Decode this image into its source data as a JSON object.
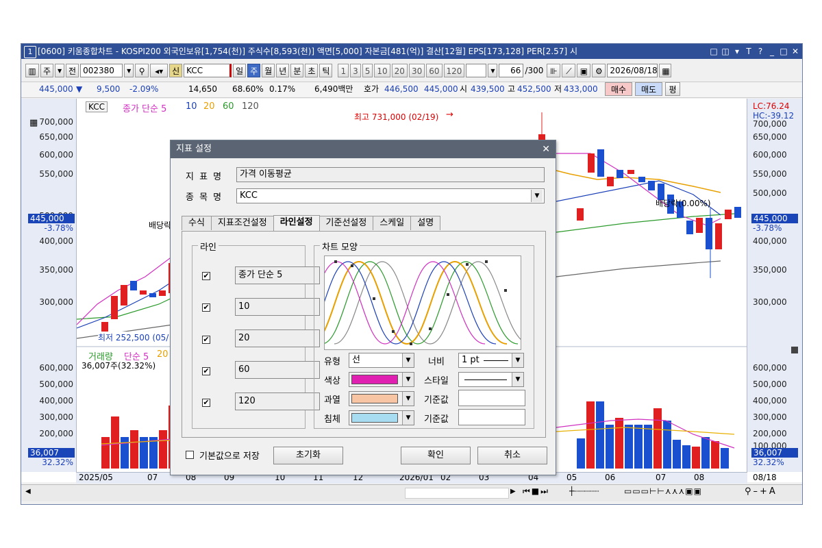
{
  "window": {
    "icon_number": "1",
    "title": "[0600] 키움종합차트 - KOSPI200 외국인보유[1,754(천)] 주식수[8,593(천)] 액면[5,000] 자본금[481(억)] 결산[12월] EPS[173,128] PER[2.57] 시",
    "title_icons": [
      "□",
      "◫",
      "▾",
      "T",
      "?",
      "_",
      "□",
      "✕"
    ]
  },
  "toolbar": {
    "period_btn": "주",
    "prev_btn": "전",
    "code": "002380",
    "new_label": "신",
    "name": "KCC",
    "timeframes": [
      "일",
      "주",
      "월",
      "년",
      "분",
      "초",
      "틱"
    ],
    "selected_timeframe": "주",
    "intervals": [
      "1",
      "3",
      "5",
      "10",
      "20",
      "30",
      "60",
      "120"
    ],
    "count": "66",
    "count_total": "/300",
    "date": "2026/08/18"
  },
  "pricebar": {
    "price": "445,000",
    "arrow": "▼",
    "change": "9,500",
    "change_pct": "-2.09%",
    "volume": "14,650",
    "vol_pct": "68.60%",
    "turnover": "0.17%",
    "amount": "6,490백만",
    "ask_label": "호가",
    "ask1": "446,500",
    "ask2": "445,000",
    "open_label": "시",
    "open": "439,500",
    "high_label": "고",
    "high": "452,500",
    "low_label": "저",
    "low": "433,000",
    "buy": "매수",
    "sell": "매도",
    "eval": "평"
  },
  "chart": {
    "legend_name": "KCC",
    "legend_ma": "종가 단순 5",
    "legend_periods": [
      "10",
      "20",
      "60",
      "120"
    ],
    "lc": "LC:76.24",
    "hc": "HC:-39.12",
    "y_ticks": [
      "700,000",
      "650,000",
      "600,000",
      "550,000",
      "500,000",
      "450,000",
      "400,000",
      "350,000",
      "300,000"
    ],
    "current_price": "445,000",
    "current_pct": "-3.78%",
    "max_label": "최고 731,000 (02/19)",
    "min_label": "최저 252,500 (05/",
    "dividend1": "배당락",
    "dividend2": "배당락(0.00%)",
    "vol_legend_name": "거래량",
    "vol_legend_ma": "단순 5",
    "vol_legend_p": "20",
    "vol_current": "36,007주(32.32%)",
    "vol_ticks": [
      "600,000",
      "500,000",
      "400,000",
      "300,000",
      "200,000",
      "100,000"
    ],
    "vol_box": "36,007",
    "vol_box_pct": "32.32%",
    "x_labels": [
      "2025/05",
      "07",
      "08",
      "09",
      "10",
      "11",
      "12",
      "2026/01",
      "02",
      "03",
      "04",
      "05",
      "06",
      "07",
      "08"
    ],
    "x_right": "08/18"
  },
  "dialog": {
    "title": "지표 설정",
    "indicator_label": "지 표 명",
    "indicator_value": "가격 이동평균",
    "stock_label": "종 목 명",
    "stock_value": "KCC",
    "tabs": [
      "수식",
      "지표조건설정",
      "라인설정",
      "기준선설정",
      "스케일",
      "설명"
    ],
    "active_tab": "라인설정",
    "line_group": "라인",
    "lines": [
      "종가 단순 5",
      "10",
      "20",
      "60",
      "120"
    ],
    "shape_group": "차트 모양",
    "type_label": "유형",
    "type_value": "선",
    "width_label": "너비",
    "width_value": "1 pt",
    "color_label": "색상",
    "color_value": "#e040c0",
    "style_label": "스타일",
    "overheat_label": "과열",
    "overheat_color": "#f7c4a4",
    "baseline_label1": "기준값",
    "depress_label": "침체",
    "depress_color": "#a8dcf0",
    "baseline_label2": "기준값",
    "save_default": "기본값으로 저장",
    "reset": "초기화",
    "ok": "확인",
    "cancel": "취소"
  }
}
